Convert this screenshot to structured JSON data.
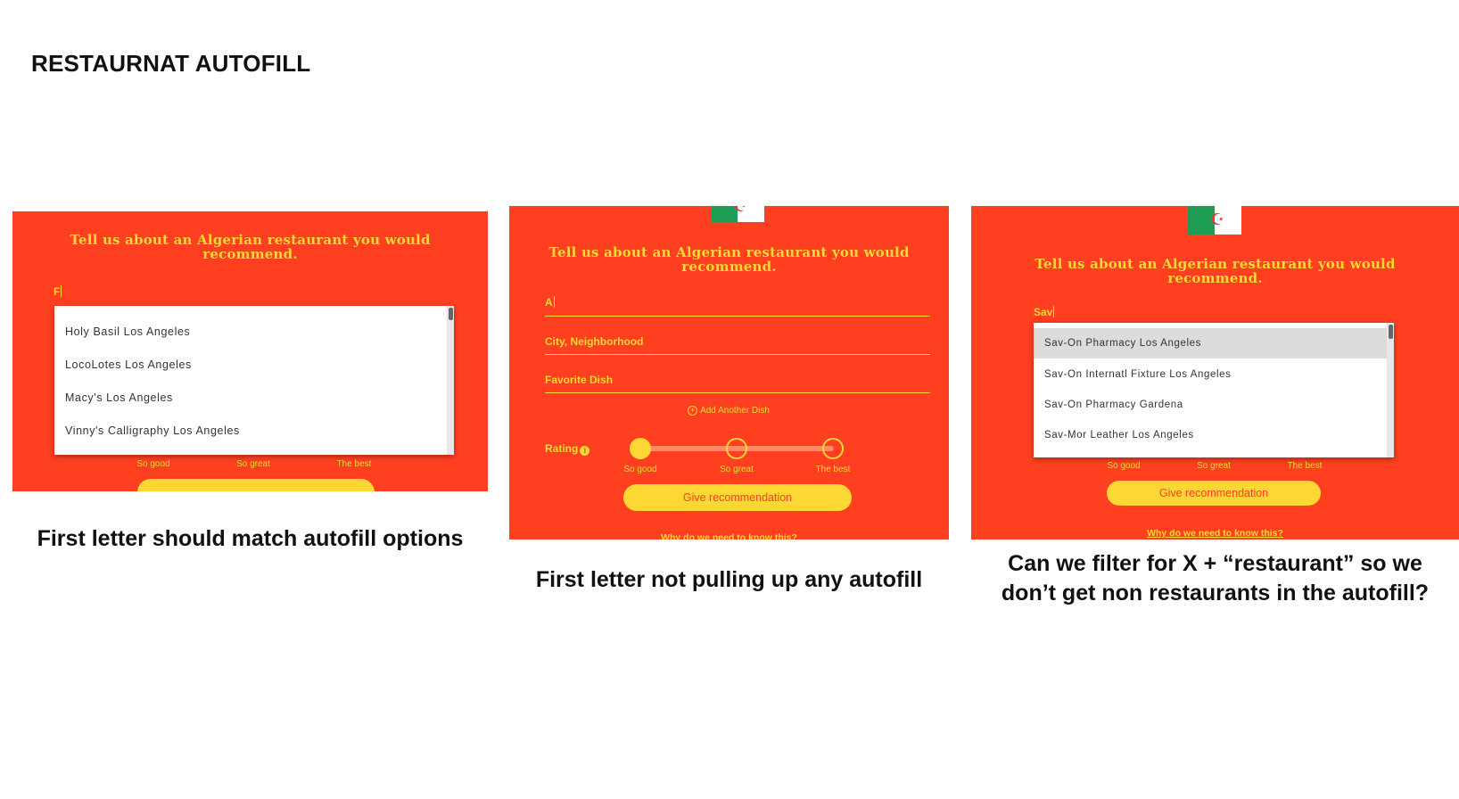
{
  "page": {
    "title": "RESTAURNAT AUTOFILL"
  },
  "theme": {
    "panel_bg": "#fe3f20",
    "accent": "#fdd835",
    "flag_green": "#1f9d55",
    "flag_red": "#e53935"
  },
  "panel1": {
    "heading": "Tell us about an Algerian restaurant you would recommend.",
    "input_value": "F",
    "suggestions": [
      "Holy Basil Los Angeles",
      "LocoLotes Los Angeles",
      "Macy's Los Angeles",
      "Vinny's Calligraphy Los Angeles"
    ],
    "rating_labels": [
      "So good",
      "So great",
      "The best"
    ],
    "caption": "First letter should match autofill options"
  },
  "panel2": {
    "heading": "Tell us about an Algerian restaurant you would recommend.",
    "input_value": "A",
    "city_placeholder": "City, Neighborhood",
    "dish_placeholder": "Favorite Dish",
    "add_dish": "Add Another Dish",
    "rating_label": "Rating",
    "info_icon": "info-icon",
    "rating_labels": [
      "So good",
      "So great",
      "The best"
    ],
    "button": "Give recommendation",
    "link": "Why do we need to know this?",
    "caption": "First letter not pulling up any autofill"
  },
  "panel3": {
    "heading": "Tell us about an Algerian restaurant you would recommend.",
    "input_value": "Sav",
    "suggestions": [
      "Sav-On Pharmacy Los Angeles",
      "Sav-On Internatl Fixture Los Angeles",
      "Sav-On Pharmacy Gardena",
      "Sav-Mor Leather Los Angeles"
    ],
    "rating_labels": [
      "So good",
      "So great",
      "The best"
    ],
    "button": "Give recommendation",
    "link": "Why do we need to know this?",
    "caption_line1": "Can we filter for X + “restaurant” so we",
    "caption_line2": "don’t get non restaurants in the autofill?"
  }
}
